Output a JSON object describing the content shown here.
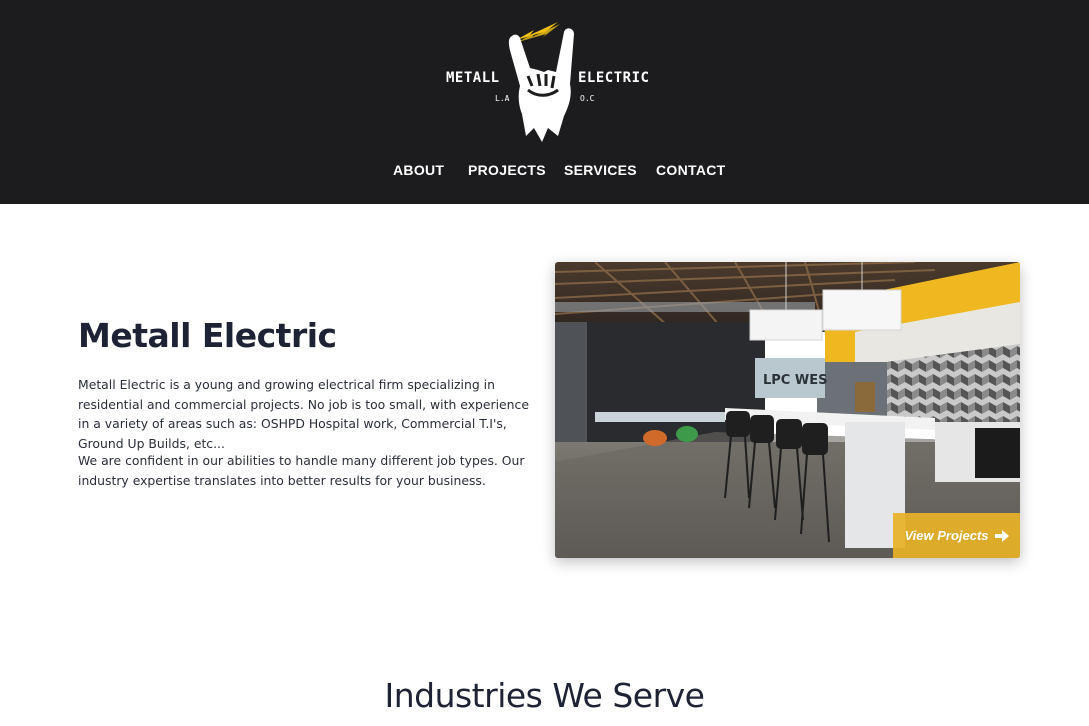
{
  "header": {
    "logo": {
      "word_left": "METALL",
      "word_right": "ELECTRIC",
      "sub_left": "L.A",
      "sub_right": "O.C",
      "bolt_color": "#f2c014",
      "hand_icon": "horns-hand-icon",
      "bolt_icon": "lightning-bolt-icon"
    },
    "nav": [
      {
        "label": "ABOUT"
      },
      {
        "label": "PROJECTS"
      },
      {
        "label": "SERVICES"
      },
      {
        "label": "CONTACT"
      }
    ],
    "background": "#1c1c1e"
  },
  "intro": {
    "title": "Metall Electric",
    "paragraph1": "Metall Electric is a young and growing electrical firm specializing in residential and commercial projects. No job is too small, with experience in a variety of areas such as: OSHPD Hospital work, Commercial T.I's, Ground Up Builds, etc...",
    "paragraph2": "We are confident in our abilities to handle many different job types. Our industry expertise translates into better results for your business."
  },
  "feature_image": {
    "sign_text": "LPC WES",
    "button_label": "View Projects",
    "button_icon": "arrow-right-icon",
    "accent": "#e8b226"
  },
  "industries": {
    "heading": "Industries We Serve"
  }
}
